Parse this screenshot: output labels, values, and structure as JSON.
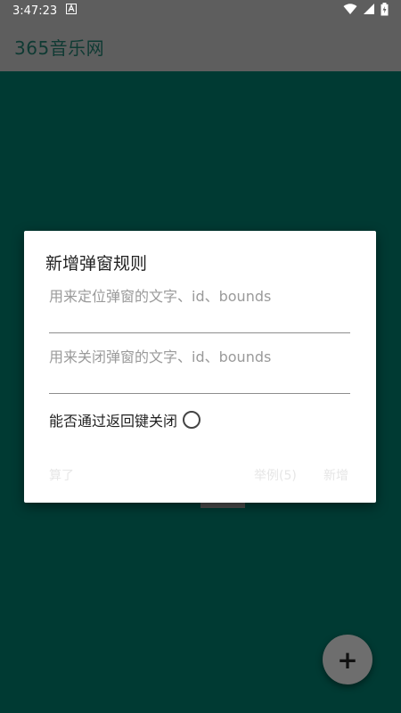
{
  "status_bar": {
    "time": "3:47:23",
    "notification_icon": "a-icon",
    "wifi_icon": "wifi-icon",
    "signal_icon": "signal-icon",
    "battery_icon": "battery-icon"
  },
  "app_bar": {
    "title": "365音乐网"
  },
  "dialog": {
    "title": "新增弹窗规则",
    "field_locate_placeholder": "用来定位弹窗的文字、id、bounds",
    "field_close_placeholder": "用来关闭弹窗的文字、id、bounds",
    "back_key_label": "能否通过返回键关闭",
    "buttons": {
      "cancel": "算了",
      "examples": "举例(5)",
      "add": "新增"
    }
  },
  "fab": {
    "label": "+"
  },
  "colors": {
    "background": "#003a33",
    "bar": "#5e5e5e",
    "dialog": "#ffffff",
    "fab": "#6e6e6e"
  }
}
